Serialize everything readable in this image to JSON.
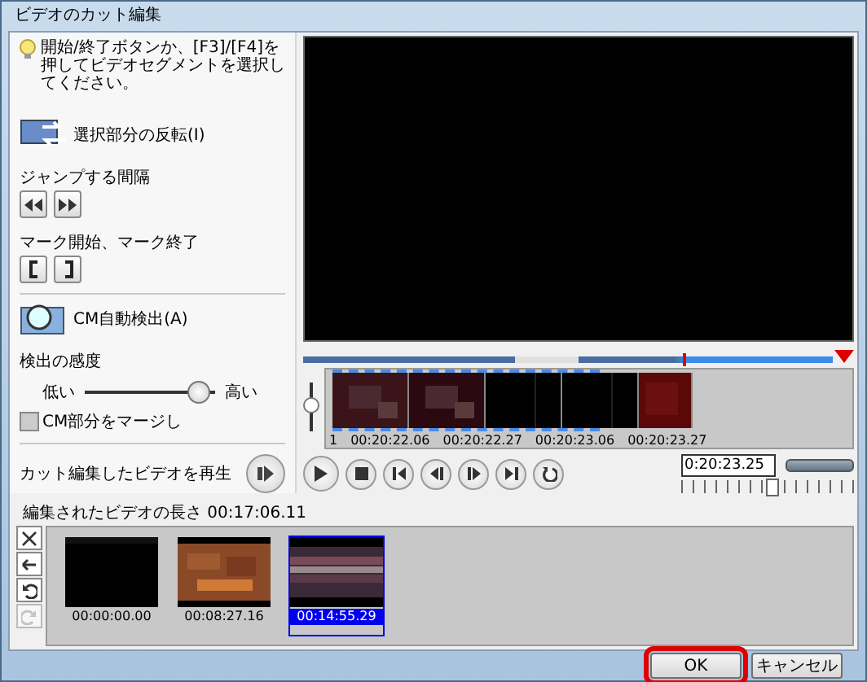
{
  "window": {
    "title": "ビデオのカット編集"
  },
  "left_panel": {
    "hint": "開始/終了ボタンか、[F3]/[F4]を押してビデオセグメントを選択してください。",
    "invert_button": "選択部分の反転(I)",
    "jump_label": "ジャンプする間隔",
    "mark_label": "マーク開始、マーク終了",
    "cm_button": "CM自動検出(A)",
    "sensitivity": {
      "label": "検出の感度",
      "low": "低い",
      "high": "高い",
      "level": 0.88
    },
    "merge": {
      "label": "CM部分をマージし",
      "checked": false
    },
    "play_edited": "カット編集したビデオを再生"
  },
  "timeline": {
    "position": {
      "level": 0.72
    },
    "labels": [
      "1",
      "00:20:22.06",
      "00:20:22.27",
      "00:20:23.06",
      "00:20:23.27"
    ],
    "time": "0:20:23.25",
    "jog": {
      "level": 0.52
    }
  },
  "edited_length": "編集されたビデオの長さ 00:17:06.11",
  "segments": [
    {
      "time": "00:00:00.00",
      "selected": false,
      "kind": "black"
    },
    {
      "time": "00:08:27.16",
      "selected": false,
      "kind": "orange"
    },
    {
      "time": "00:14:55.29",
      "selected": true,
      "kind": "purple"
    }
  ],
  "buttons": [
    {
      "label": "OK",
      "highlighted": true
    },
    {
      "label": "キャンセル",
      "highlighted": false
    }
  ]
}
